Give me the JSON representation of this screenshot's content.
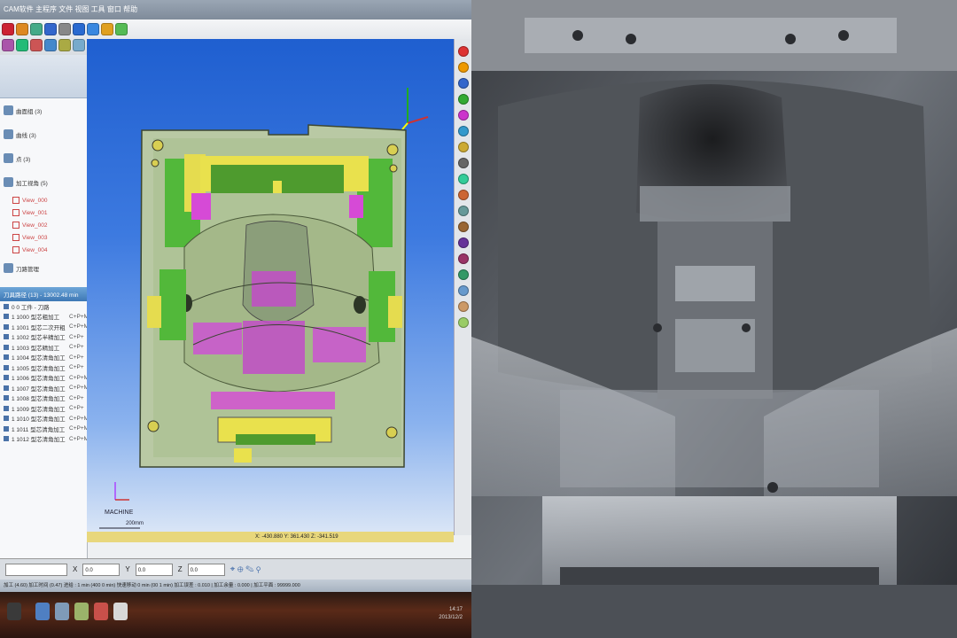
{
  "window": {
    "title": "CAM软件 主程序 文件 视图 工具 窗口 帮助"
  },
  "toolbar": {
    "tool_icons": [
      "new-icon",
      "open-icon",
      "save-icon",
      "undo-icon",
      "redo-icon",
      "view-iso-icon",
      "view-top-icon",
      "view-front-icon",
      "shade-icon",
      "wire-icon",
      "zoom-icon",
      "pan-icon",
      "rotate-icon",
      "fit-icon",
      "measure-icon",
      "layer-icon",
      "color-icon",
      "help-icon"
    ],
    "view_number": "1"
  },
  "tree": {
    "items": [
      {
        "label": "曲面组 (3)",
        "icon": "surface-icon"
      },
      {
        "label": "曲线 (3)",
        "icon": "curve-icon"
      },
      {
        "label": "点 (3)",
        "icon": "point-icon"
      },
      {
        "label": "加工视角 (5)",
        "icon": "view-icon"
      }
    ],
    "views": [
      "View_000",
      "View_001",
      "View_002",
      "View_003",
      "View_004"
    ],
    "path_item": "刀路管理",
    "operations_header": "刀具路径 (13) - 13002.48 min",
    "operations": [
      {
        "name": "0 0  工件 - 刀路",
        "axis": ""
      },
      {
        "name": "1 1000  型芯粗加工",
        "axis": "C+P+M"
      },
      {
        "name": "1 1001  型芯二次开粗",
        "axis": "C+P+M"
      },
      {
        "name": "1 1002  型芯半精加工",
        "axis": "C+P+"
      },
      {
        "name": "1 1003  型芯精加工",
        "axis": "C+P+"
      },
      {
        "name": "1 1004  型芯清角加工",
        "axis": "C+P+"
      },
      {
        "name": "1 1005  型芯清角加工",
        "axis": "C+P+"
      },
      {
        "name": "1 1006  型芯清角加工",
        "axis": "C+P+M"
      },
      {
        "name": "1 1007  型芯清角加工",
        "axis": "C+P+M"
      },
      {
        "name": "1 1008  型芯清角加工",
        "axis": "C+P+"
      },
      {
        "name": "1 1009  型芯清角加工",
        "axis": "C+P+"
      },
      {
        "name": "1 1010  型芯清角加工",
        "axis": "C+P+M"
      },
      {
        "name": "1 1011  型芯清角加工",
        "axis": "C+P+M"
      },
      {
        "name": "1 1012  型芯清角加工",
        "axis": "C+P+M"
      }
    ]
  },
  "viewport": {
    "machine_label": "MACHINE",
    "scale_label": "200mm",
    "axis_z": "Z",
    "axis_x": "X"
  },
  "coordbar": {
    "text": "X: -430.880   Y: 361.430   Z: -341.519"
  },
  "inputbar": {
    "label_x": "X",
    "label_y": "Y",
    "label_z": "Z",
    "value_x": "0.0",
    "value_y": "0.0",
    "value_z": "0.0"
  },
  "statusbar": {
    "text": "加工 (4.60)  加工时间 (0.47)  进给 : 1 min  (400 0 min)  快速移动 0 min  (00 1 min)  加工误差 : 0.010  | 加工余量 : 0.000 | 加工平面 : 99999.000"
  },
  "taskbar": {
    "time": "14:17",
    "date": "2013/12/2"
  }
}
